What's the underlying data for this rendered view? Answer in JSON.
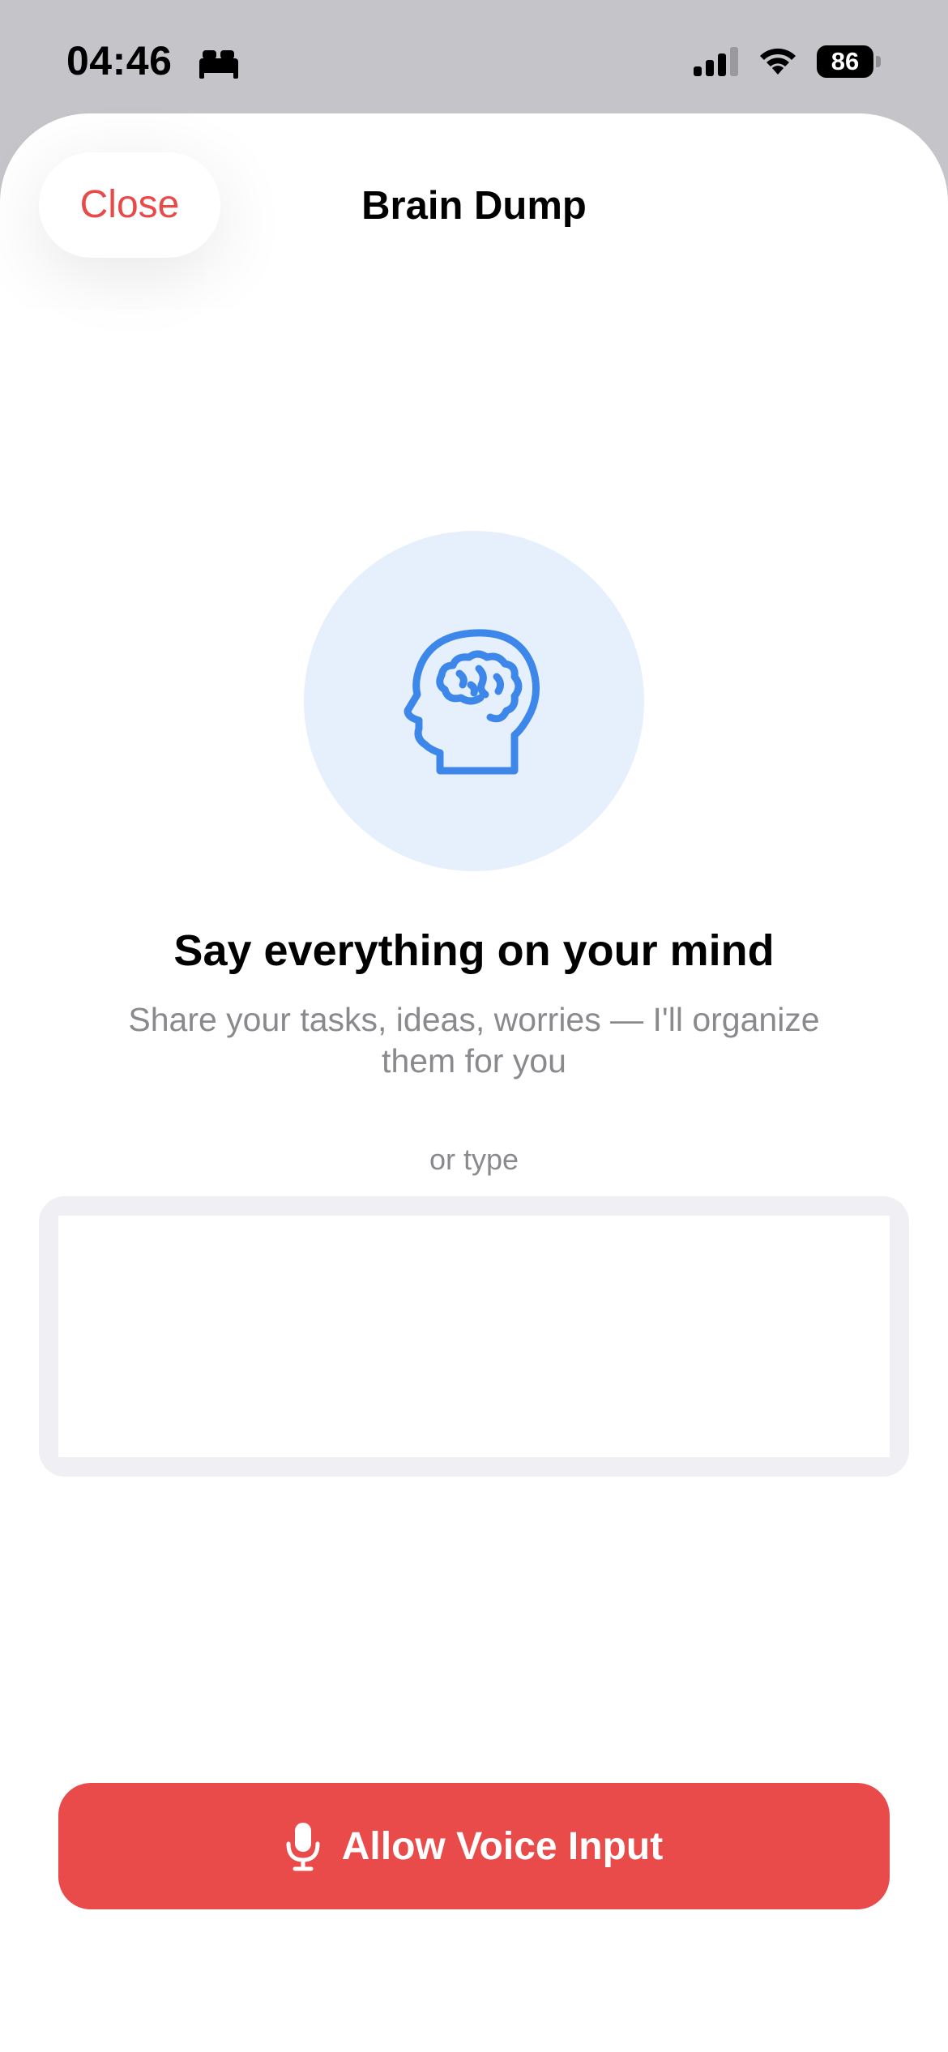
{
  "status_bar": {
    "time": "04:46",
    "battery": "86",
    "icons": [
      "bed-icon",
      "signal-icon",
      "wifi-icon",
      "battery-icon"
    ]
  },
  "sheet": {
    "close_label": "Close",
    "title": "Brain Dump"
  },
  "hero": {
    "icon": "brain-head-icon",
    "headline": "Say everything on your mind",
    "subtext": "Share your tasks, ideas, worries — I'll organize them for you"
  },
  "input": {
    "or_label": "or type",
    "value": "",
    "placeholder": ""
  },
  "voice_button": {
    "label": "Allow Voice Input",
    "icon": "microphone-icon"
  },
  "colors": {
    "accent_red": "#e94b4b",
    "brain_blue": "#3d87ea",
    "circle_bg": "#e6f0fc"
  }
}
